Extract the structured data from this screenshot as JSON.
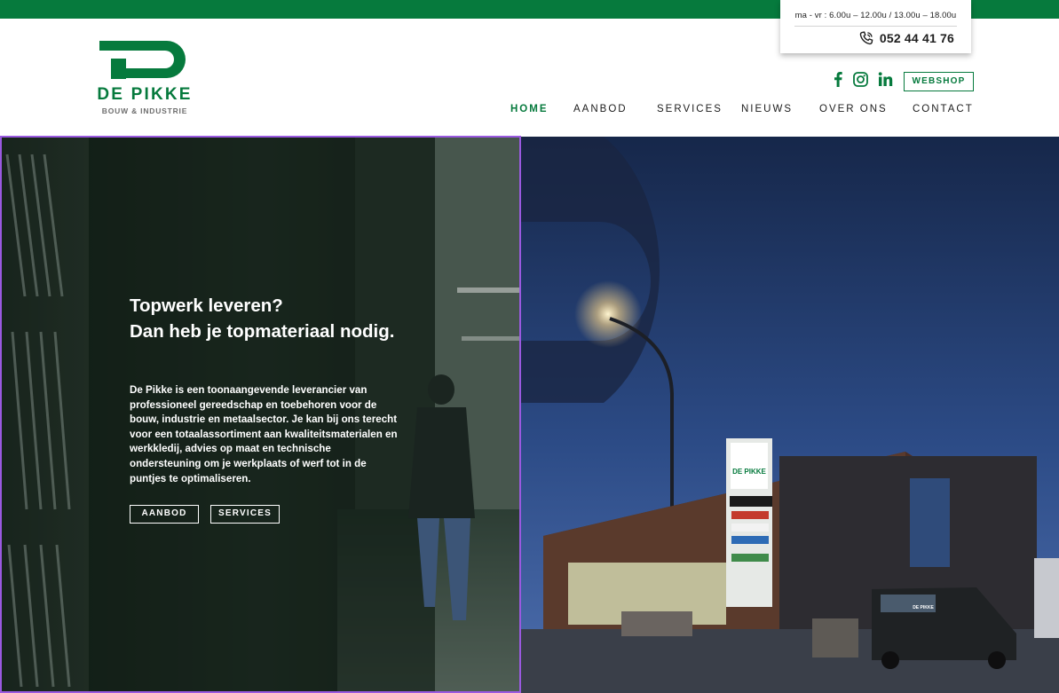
{
  "topbar": {
    "color": "#067a3d"
  },
  "contact": {
    "hours": "ma - vr : 6.00u – 12.00u / 13.00u – 18.00u",
    "phone": "052 44 41 76",
    "phone_icon": "phone-icon"
  },
  "logo": {
    "title": "DE PIKKE",
    "subtitle": "BOUW & INDUSTRIE",
    "brand_color": "#067a3d"
  },
  "social": [
    {
      "name": "facebook-icon"
    },
    {
      "name": "instagram-icon"
    },
    {
      "name": "linkedin-icon"
    }
  ],
  "header": {
    "webshop_label": "WEBSHOP"
  },
  "nav": {
    "items": [
      {
        "label": "HOME",
        "active": true
      },
      {
        "label": "AANBOD",
        "active": false
      },
      {
        "label": "SERVICES",
        "active": false
      },
      {
        "label": "NIEUWS",
        "active": false
      },
      {
        "label": "OVER ONS",
        "active": false
      },
      {
        "label": "CONTACT",
        "active": false
      }
    ]
  },
  "hero": {
    "heading_line1": "Topwerk leveren?",
    "heading_line2": "Dan heb je topmateriaal nodig.",
    "text": "De Pikke is een toonaangevende leverancier van professioneel gereedschap en toebehoren voor de bouw, industrie en metaalsector. Je kan bij ons terecht voor een totaalassortiment aan kwaliteitsmaterialen en werkkledij, advies op maat en technische ondersteuning om je werkplaats of werf tot in de puntjes te optimaliseren.",
    "buttons": [
      {
        "label": "AANBOD"
      },
      {
        "label": "SERVICES"
      }
    ],
    "pylon_sign": "DE PIKKE",
    "van_label": "DE PIKKE"
  }
}
